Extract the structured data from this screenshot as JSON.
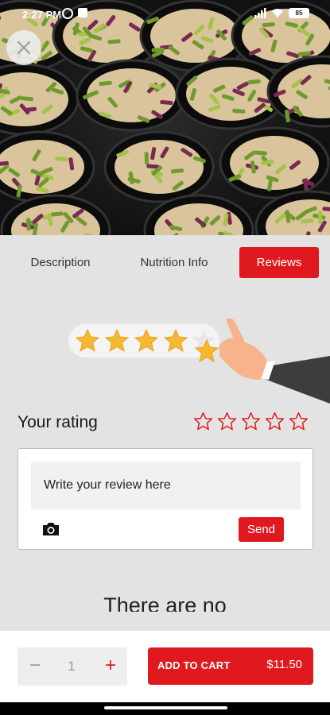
{
  "status_bar": {
    "time": "2:27 PM",
    "battery": "85"
  },
  "hero": {
    "image_subject": "meal prep containers with chicken, green peppers and red onions"
  },
  "close": {
    "icon": "close-icon"
  },
  "tabs": [
    {
      "label": "Description",
      "active": false
    },
    {
      "label": "Nutrition Info",
      "active": false
    },
    {
      "label": "Reviews",
      "active": true
    }
  ],
  "rating": {
    "label": "Your rating",
    "max_stars": 5,
    "selected": 0
  },
  "review": {
    "placeholder": "Write your review here",
    "send_label": "Send"
  },
  "empty_state": {
    "text": "There are no"
  },
  "cart": {
    "quantity": "1",
    "minus": "−",
    "plus": "+",
    "add_label": "ADD TO CART",
    "price": "$11.50"
  },
  "colors": {
    "accent": "#e0191f",
    "background": "#e3e3e3"
  }
}
